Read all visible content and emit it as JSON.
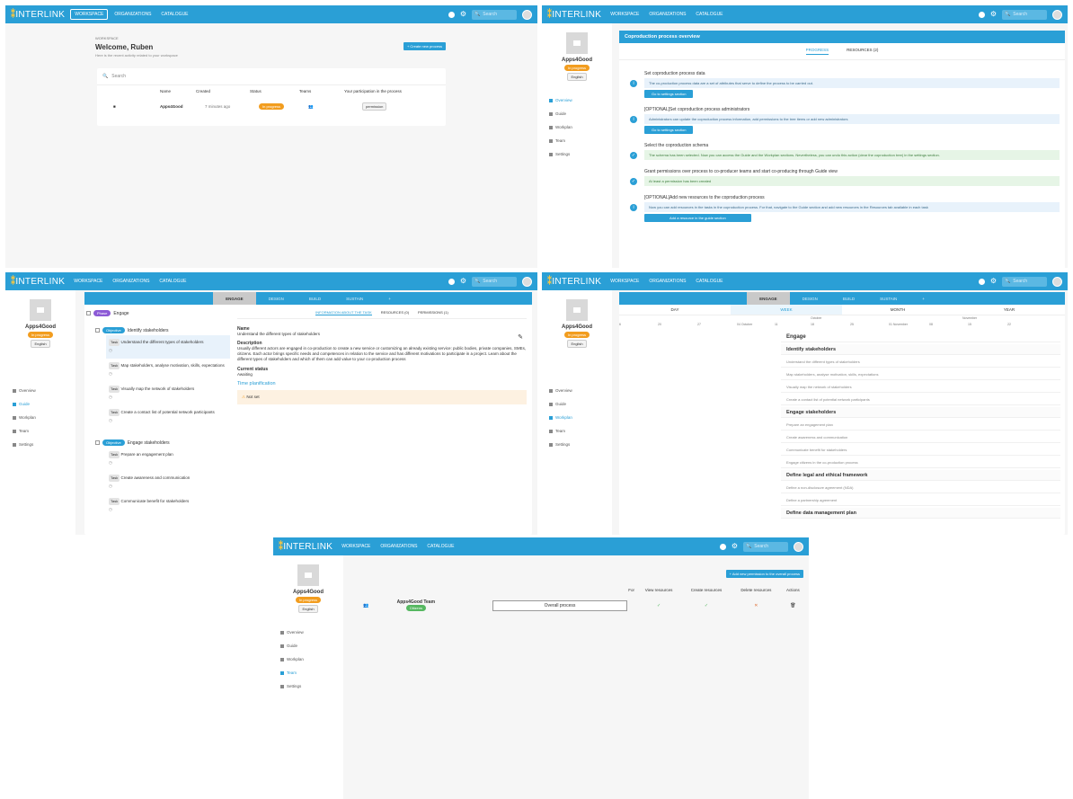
{
  "app": {
    "logo": "INTERLINK",
    "nav": [
      "WORKSPACE",
      "ORGANIZATIONS",
      "CATALOGUE"
    ],
    "search_placeholder": "Search"
  },
  "project": {
    "name": "Apps4Good",
    "status": "In progress",
    "language": "English"
  },
  "sidebar_items": [
    "Overview",
    "Guide",
    "Workplan",
    "Team",
    "Settings"
  ],
  "workspace": {
    "eyebrow": "WORKSPACE",
    "welcome": "Welcome, Ruben",
    "subtitle": "Here is the recent activity related to your workspace",
    "create_button": "+ Create new process",
    "search_placeholder": "Search",
    "columns": [
      "Name",
      "Created",
      "Status",
      "Teams",
      "Your participation in the process"
    ],
    "row": {
      "name": "Apps4Good",
      "created": "7 minutes ago",
      "status": "In progress",
      "participation": "permission"
    }
  },
  "overview": {
    "header": "Coproduction process overview",
    "tabs": [
      "PROGRESS",
      "RESOURCES (2)"
    ],
    "steps": [
      {
        "title": "Set coproduction process data",
        "info": "The co-production process data are a set of attributes that serve to define the process to be carried out.",
        "button": "Go to settings section",
        "done": false
      },
      {
        "title": "[OPTIONAL]Set coproduction process administrators",
        "info": "Administrators can update the coproduction process information, add permissions to the tree items or add new administrators",
        "button": "Go to settings section",
        "done": false
      },
      {
        "title": "Select the coproduction schema",
        "info": "The schema has been selected. Now you can access the Guide and the Workplan sections. Nevertheless, you can undo this action (clear the coproduction tree) in the settings section.",
        "button": "",
        "done": true
      },
      {
        "title": "Grant permissions over process to co-producer teams and start co-producing through Guide view",
        "info": "At least a permission has been created",
        "button": "",
        "done": true
      },
      {
        "title": "[OPTIONAL]Add new resources to the coproduction process",
        "info": "Now you can add resources in the tasks in the coproduction process. For that, navigate to the Guide section and add new resources in the Resources tab available in each task",
        "button": "Add a resource in the guide section",
        "done": false
      }
    ]
  },
  "guide": {
    "phase_tabs": [
      "ENGAGE",
      "DESIGN",
      "BUILD",
      "SUSTAIN",
      "+"
    ],
    "detail_tabs": [
      "INFORMATION ABOUT THE TASK",
      "RESOURCES (0)",
      "PERMISSIONS (1)"
    ],
    "tree": {
      "phase": "Engage",
      "phase_tag": "Phase",
      "objectives": [
        {
          "tag": "Objective",
          "name": "Identify stakeholders",
          "tasks": [
            "Understand the different types of stakeholders",
            "Map stakeholders, analyse motivation, skills, expectations",
            "Visually map the network of stakeholders",
            "Create a contact list of potential network participants"
          ]
        },
        {
          "tag": "Objective",
          "name": "Engage stakeholders",
          "tasks": [
            "Prepare an engagement plan",
            "Create awareness and communication",
            "Communicate benefit for stakeholders"
          ]
        }
      ],
      "task_tag": "Task"
    },
    "detail": {
      "name_label": "Name",
      "name": "Understand the different types of stakeholders",
      "desc_label": "Description",
      "desc": "Usually different actors are engaged in co-production to create a new service or customizing an already existing service: public bodies, private companies, SMEs, citizens. Each actor brings specific needs and competences in relation to the service and has different motivations to participate in a project. Learn about the different types of stakeholders and which of them can add value to your co-production process",
      "status_label": "Current status",
      "status": "Awaiting",
      "time_label": "Time planification",
      "warning": "Not set"
    }
  },
  "workplan": {
    "phase_tabs": [
      "ENGAGE",
      "DESIGN",
      "BUILD",
      "SUSTAIN",
      "+"
    ],
    "scales": [
      "DAY",
      "WEEK",
      "MONTH",
      "YEAR"
    ],
    "dates": [
      "6",
      "20",
      "27",
      "04 October",
      "11",
      "18",
      "25",
      "01 November",
      "08",
      "15",
      "22"
    ],
    "months": [
      "October",
      "November"
    ],
    "rows": [
      {
        "t": "Engage",
        "k": "h"
      },
      {
        "t": "Identify stakeholders",
        "k": "sh"
      },
      {
        "t": "Understand the different types of stakeholders",
        "k": "t"
      },
      {
        "t": "Map stakeholders, analyse motivation, skills, expectations",
        "k": "t"
      },
      {
        "t": "Visually map the network of stakeholders",
        "k": "t"
      },
      {
        "t": "Create a contact list of potential network participants",
        "k": "t"
      },
      {
        "t": "Engage stakeholders",
        "k": "sh"
      },
      {
        "t": "Prepare an engagement plan",
        "k": "t"
      },
      {
        "t": "Create awareness and communication",
        "k": "t"
      },
      {
        "t": "Communicate benefit for stakeholders",
        "k": "t"
      },
      {
        "t": "Engage citizens in the co-production process",
        "k": "t"
      },
      {
        "t": "Define legal and ethical framework",
        "k": "sh"
      },
      {
        "t": "Define a non-disclosure agreement (NDA)",
        "k": "t"
      },
      {
        "t": "Define a partnership agreement",
        "k": "t"
      },
      {
        "t": "Define data management plan",
        "k": "sh"
      }
    ]
  },
  "team": {
    "add_button": "+ Add new permission to the overall process",
    "columns": [
      "For",
      "View resources",
      "Create resources",
      "Delete resources",
      "Actions"
    ],
    "row": {
      "team": "Apps4Good Team",
      "badge": "Citizens",
      "for": "Overall process",
      "view": "✓",
      "create": "✓",
      "delete": "✕"
    }
  }
}
